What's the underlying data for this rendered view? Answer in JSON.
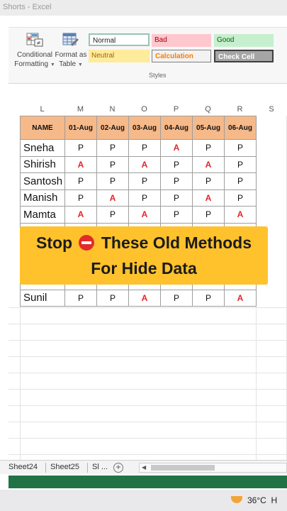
{
  "window": {
    "title": "Shorts - Excel"
  },
  "ribbon": {
    "conditional_formatting": {
      "line1": "Conditional",
      "line2": "Formatting"
    },
    "format_as_table": {
      "line1": "Format as",
      "line2": "Table"
    },
    "styles": {
      "normal": "Normal",
      "bad": "Bad",
      "good": "Good",
      "neutral": "Neutral",
      "calculation": "Calculation",
      "check_cell": "Check Cell",
      "group_label": "Styles"
    }
  },
  "columns": [
    "L",
    "M",
    "N",
    "O",
    "P",
    "Q",
    "R",
    "S"
  ],
  "table": {
    "header": [
      "NAME",
      "01-Aug",
      "02-Aug",
      "03-Aug",
      "04-Aug",
      "05-Aug",
      "06-Aug"
    ],
    "rows": [
      {
        "name": "Sneha",
        "vals": [
          "P",
          "P",
          "P",
          "A",
          "P",
          "P"
        ]
      },
      {
        "name": "Shirish",
        "vals": [
          "A",
          "P",
          "A",
          "P",
          "A",
          "P"
        ]
      },
      {
        "name": "Santosh",
        "vals": [
          "P",
          "P",
          "P",
          "P",
          "P",
          "P"
        ]
      },
      {
        "name": "Manish",
        "vals": [
          "P",
          "A",
          "P",
          "P",
          "A",
          "P"
        ]
      },
      {
        "name": "Mamta",
        "vals": [
          "A",
          "P",
          "A",
          "P",
          "P",
          "A"
        ]
      },
      {
        "name": "",
        "vals": [
          "",
          "",
          "",
          "",
          "",
          ""
        ]
      },
      {
        "name": "",
        "vals": [
          "",
          "",
          "",
          "",
          "",
          ""
        ]
      },
      {
        "name": "",
        "vals": [
          "",
          "",
          "",
          "",
          "",
          ""
        ]
      },
      {
        "name": "",
        "vals": [
          "",
          "",
          "",
          "",
          "",
          ""
        ]
      },
      {
        "name": "Sunil",
        "vals": [
          "P",
          "P",
          "A",
          "P",
          "P",
          "A"
        ]
      }
    ]
  },
  "banner": {
    "line1_start": "Stop",
    "line1_end": "These Old Methods",
    "line2": "For Hide Data"
  },
  "sheet_tabs": [
    "Sheet24",
    "Sheet25",
    "Sl ..."
  ],
  "taskbar": {
    "temperature": "36°C",
    "extra": "H"
  },
  "colors": {
    "header_fill": "#f6b98a",
    "absent_red": "#e02626",
    "banner": "#ffc22c",
    "status_green": "#217346"
  }
}
